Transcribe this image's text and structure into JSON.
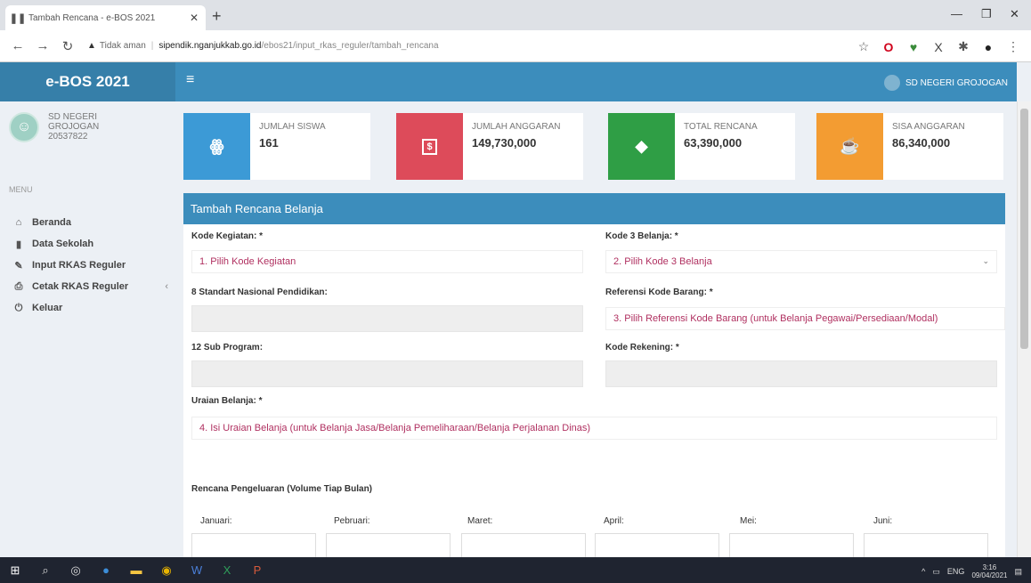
{
  "browser": {
    "tab_title": "Tambah Rencana - e-BOS 2021",
    "new_tab": "+",
    "url_warning": "Tidak aman",
    "url_host": "sipendik.nganjukkab.go.id",
    "url_path": "/ebos21/input_rkas_reguler/tambah_rencana"
  },
  "app": {
    "brand": "e-BOS 2021",
    "school_top": "SD NEGERI GROJOGAN"
  },
  "sidebar": {
    "school_name_line1": "SD NEGERI",
    "school_name_line2": "GROJOGAN",
    "npsn": "20537822",
    "menu_header": "MENU",
    "items": [
      {
        "label": "Beranda",
        "icon": "home-icon"
      },
      {
        "label": "Data Sekolah",
        "icon": "book-icon"
      },
      {
        "label": "Input RKAS Reguler",
        "icon": "edit-icon"
      },
      {
        "label": "Cetak RKAS Reguler",
        "icon": "print-icon"
      },
      {
        "label": "Keluar",
        "icon": "power-icon"
      }
    ]
  },
  "stats": [
    {
      "label": "JUMLAH SISWA",
      "value": "161",
      "color": "#3c9ad6",
      "icon": "users-icon"
    },
    {
      "label": "JUMLAH ANGGARAN",
      "value": "149,730,000",
      "color": "#dd4b5a",
      "icon": "money-icon"
    },
    {
      "label": "TOTAL RENCANA",
      "value": "63,390,000",
      "color": "#2f9e45",
      "icon": "tag-icon"
    },
    {
      "label": "SISA ANGGARAN",
      "value": "86,340,000",
      "color": "#f39c32",
      "icon": "coffee-icon"
    }
  ],
  "form": {
    "title": "Tambah Rencana Belanja",
    "kode_kegiatan_label": "Kode Kegiatan: *",
    "kode_kegiatan_value": "1. Pilih Kode Kegiatan",
    "kode3_label": "Kode 3 Belanja: *",
    "kode3_value": "2. Pilih Kode 3 Belanja",
    "snp_label": "8 Standart Nasional Pendidikan:",
    "ref_label": "Referensi Kode Barang: *",
    "ref_value": "3. Pilih Referensi Kode Barang (untuk Belanja Pegawai/Persediaan/Modal)",
    "subprog_label": "12 Sub Program:",
    "rekening_label": "Kode Rekening: *",
    "uraian_label": "Uraian Belanja: *",
    "uraian_value": "4. Isi Uraian Belanja (untuk Belanja Jasa/Belanja Pemeliharaan/Belanja Perjalanan Dinas)",
    "rencana_label": "Rencana Pengeluaran (Volume Tiap Bulan)",
    "months": [
      "Januari:",
      "Pebruari:",
      "Maret:",
      "April:",
      "Mei:",
      "Juni:"
    ]
  },
  "taskbar": {
    "lang": "ENG",
    "time": "3:16",
    "date": "09/04/2021"
  }
}
